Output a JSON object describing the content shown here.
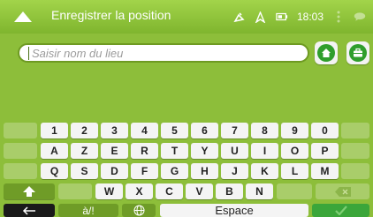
{
  "title_bar": {
    "title": "Enregistrer la position",
    "time": "18:03"
  },
  "search": {
    "placeholder": "Saisir nom du lieu",
    "value": ""
  },
  "keyboard": {
    "row_numbers": [
      "1",
      "2",
      "3",
      "4",
      "5",
      "6",
      "7",
      "8",
      "9",
      "0"
    ],
    "row_a": [
      "A",
      "Z",
      "E",
      "R",
      "T",
      "Y",
      "U",
      "I",
      "O",
      "P"
    ],
    "row_q": [
      "Q",
      "S",
      "D",
      "F",
      "G",
      "H",
      "J",
      "K",
      "L",
      "M"
    ],
    "row_w": [
      "W",
      "X",
      "C",
      "V",
      "B",
      "N"
    ],
    "symbols_label": "à/!",
    "space_label": "Espace"
  },
  "colors": {
    "background": "#8dbe3a",
    "accent_green": "#3ba63a",
    "key": "#f4f4f4"
  }
}
